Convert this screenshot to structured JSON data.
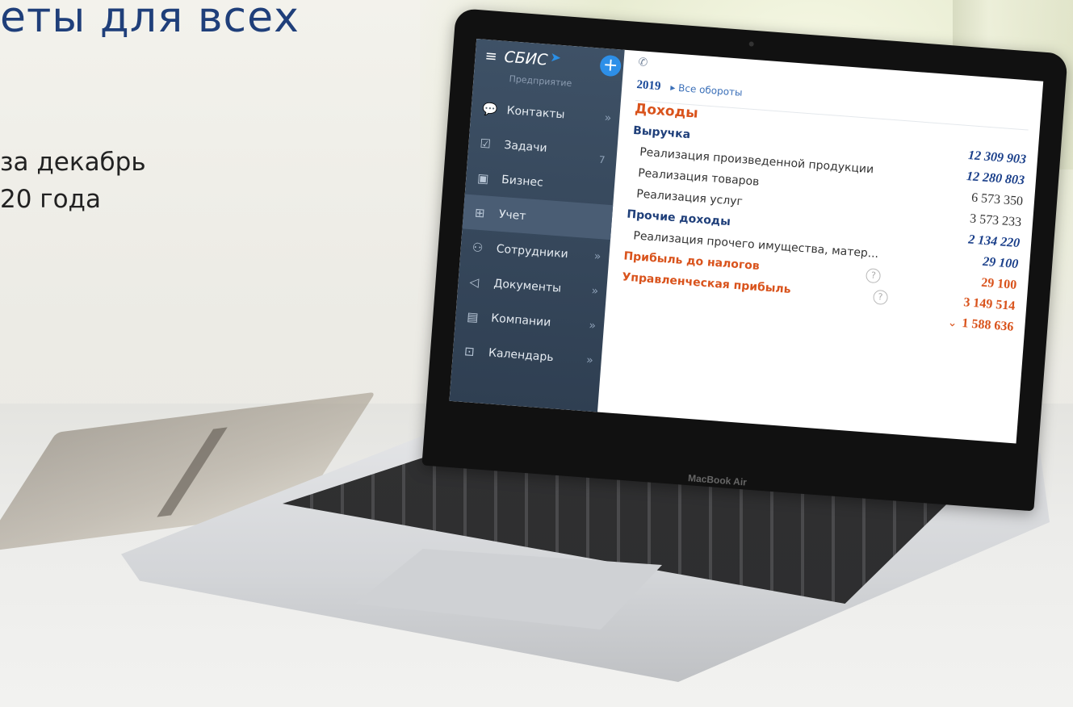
{
  "headline": "еты для всех",
  "subtitle": {
    "line1": "за декабрь",
    "line2": "20 года"
  },
  "laptop": {
    "brand": "MacBook Air"
  },
  "app": {
    "logo": "СБИС",
    "company": "Предприятие",
    "nav": [
      {
        "label": "Контакты",
        "icon": "chat-icon",
        "chevron": "»",
        "active": false
      },
      {
        "label": "Задачи",
        "icon": "task-icon",
        "count": "7",
        "active": false
      },
      {
        "label": "Бизнес",
        "icon": "briefcase-icon",
        "active": false
      },
      {
        "label": "Учет",
        "icon": "calculator-icon",
        "active": true
      },
      {
        "label": "Сотрудники",
        "icon": "people-icon",
        "chevron": "»",
        "active": false
      },
      {
        "label": "Документы",
        "icon": "send-icon",
        "chevron": "»",
        "active": false
      },
      {
        "label": "Компании",
        "icon": "company-icon",
        "chevron": "»",
        "active": false
      },
      {
        "label": "Календарь",
        "icon": "calendar-icon",
        "chevron": "»",
        "active": false
      }
    ],
    "period": {
      "year": "2019",
      "link": "Все обороты"
    },
    "rows": [
      {
        "name": "Доходы",
        "value": "",
        "style": "h1"
      },
      {
        "name": "Выручка",
        "value": "12 309 903",
        "style": "h2"
      },
      {
        "name": "Реализация произведенной продукции",
        "value": "12 280 803",
        "style": "indent blue"
      },
      {
        "name": "Реализация товаров",
        "value": "6 573 350",
        "style": "indent"
      },
      {
        "name": "Реализация услуг",
        "value": "3 573 233",
        "style": "indent"
      },
      {
        "name": "Прочие доходы",
        "value": "2 134 220",
        "style": "h2"
      },
      {
        "name": "Реализация прочего имущества, матер...",
        "value": "29 100",
        "style": "indent blue"
      },
      {
        "name": "Прибыль до налогов",
        "value": "29 100",
        "style": "orange help"
      },
      {
        "name": "Управленческая прибыль",
        "value": "3 149 514",
        "style": "orange help"
      },
      {
        "name": "",
        "value": "1 588 636",
        "style": "orange chevron"
      }
    ]
  }
}
